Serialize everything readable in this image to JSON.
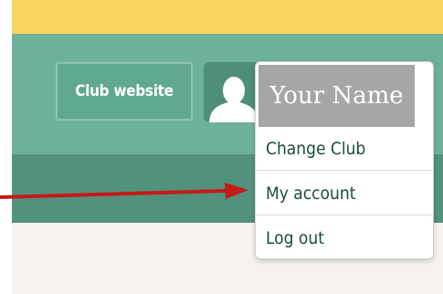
{
  "colors": {
    "top_bar": "#f9d45e",
    "header": "#6eb29a",
    "subnav": "#52927c",
    "page_background": "#f6f3ef",
    "arrow": "#c31a1a"
  },
  "header": {
    "club_website_label": "Club website",
    "avatar_icon": "person-silhouette-icon"
  },
  "user_menu": {
    "user_name": "Your Name",
    "items": [
      "Change Club",
      "My account",
      "Log out"
    ]
  },
  "annotation": {
    "icon": "red-arrow-icon"
  }
}
